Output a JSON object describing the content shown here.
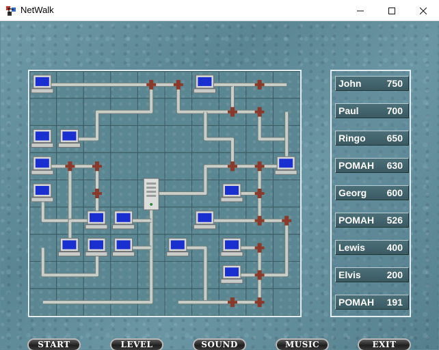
{
  "window": {
    "title": "NetWalk",
    "min_icon": "minimize-icon",
    "max_icon": "maximize-icon",
    "close_icon": "close-icon"
  },
  "scores": [
    {
      "name": "John",
      "score": "750"
    },
    {
      "name": "Paul",
      "score": "700"
    },
    {
      "name": "Ringo",
      "score": "650"
    },
    {
      "name": "POMAH",
      "score": "630"
    },
    {
      "name": "Georg",
      "score": "600"
    },
    {
      "name": "POMAH",
      "score": "526"
    },
    {
      "name": "Lewis",
      "score": "400"
    },
    {
      "name": "Elvis",
      "score": "200"
    },
    {
      "name": "POMAH",
      "score": "191"
    }
  ],
  "buttons": {
    "start": "START",
    "level": "LEVEL",
    "sound": "SOUND",
    "music": "MUSIC",
    "exit": "EXIT"
  },
  "board": {
    "cols": 10,
    "rows": 9,
    "server": {
      "col": 4,
      "row": 4
    },
    "computers": [
      [
        0,
        0
      ],
      [
        6,
        0
      ],
      [
        0,
        2
      ],
      [
        1,
        2
      ],
      [
        0,
        3
      ],
      [
        9,
        3
      ],
      [
        0,
        4
      ],
      [
        7,
        4
      ],
      [
        2,
        5
      ],
      [
        3,
        5
      ],
      [
        6,
        5
      ],
      [
        1,
        6
      ],
      [
        2,
        6
      ],
      [
        3,
        6
      ],
      [
        5,
        6
      ],
      [
        7,
        6
      ],
      [
        7,
        7
      ]
    ],
    "colors": {
      "pipe": "#c9cfc8",
      "pipe_shadow": "#6f7e7b",
      "valve": "#8a3a2a",
      "screen": "#1a2fd0",
      "grid": "#3c5d66"
    }
  }
}
